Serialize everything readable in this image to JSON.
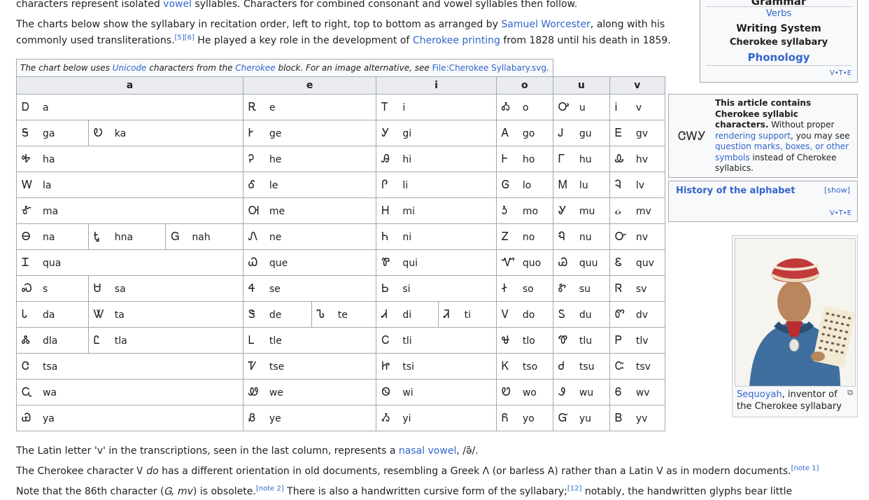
{
  "intro": {
    "line0_a": "characters represent isolated ",
    "line0_link": "vowel",
    "line0_b": " syllables. Characters for combined consonant and vowel syllables then follow.",
    "line1_a": "The charts below show the syllabary in recitation order, left to right, top to bottom as arranged by ",
    "line1_link": "Samuel Worcester",
    "line1_b": ", along with his",
    "line2_a": "commonly used transliterations.",
    "line2_ref": "[5][6]",
    "line2_b": " He played a key role in the development of ",
    "line2_link": "Cherokee printing",
    "line2_c": " from 1828 until his death in 1859."
  },
  "table": {
    "caption_a": "The chart below uses ",
    "caption_link1": "Unicode",
    "caption_b": " characters from the ",
    "caption_link2": "Cherokee",
    "caption_c": " block. For an image alternative, see ",
    "caption_link3": "File:Cherokee Syllabary.svg",
    "caption_d": ".",
    "headers": [
      "a",
      "e",
      "i",
      "o",
      "u",
      "v"
    ],
    "rows": [
      {
        "a": [
          [
            "Ꭰ",
            "a"
          ]
        ],
        "e": [
          [
            "Ꭱ",
            "e"
          ]
        ],
        "i": [
          [
            "Ꭲ",
            "i"
          ]
        ],
        "o": [
          [
            "Ꭳ",
            "o"
          ]
        ],
        "u": [
          [
            "Ꭴ",
            "u"
          ]
        ],
        "v": [
          [
            "Ꭵ",
            "v"
          ]
        ]
      },
      {
        "a": [
          [
            "Ꭶ",
            "ga"
          ],
          [
            "Ꭷ",
            "ka"
          ]
        ],
        "e": [
          [
            "Ꭸ",
            "ge"
          ]
        ],
        "i": [
          [
            "Ꭹ",
            "gi"
          ]
        ],
        "o": [
          [
            "Ꭺ",
            "go"
          ]
        ],
        "u": [
          [
            "Ꭻ",
            "gu"
          ]
        ],
        "v": [
          [
            "Ꭼ",
            "gv"
          ]
        ]
      },
      {
        "a": [
          [
            "Ꭽ",
            "ha"
          ]
        ],
        "e": [
          [
            "Ꭾ",
            "he"
          ]
        ],
        "i": [
          [
            "Ꭿ",
            "hi"
          ]
        ],
        "o": [
          [
            "Ꮀ",
            "ho"
          ]
        ],
        "u": [
          [
            "Ꮁ",
            "hu"
          ]
        ],
        "v": [
          [
            "Ꮂ",
            "hv"
          ]
        ]
      },
      {
        "a": [
          [
            "Ꮃ",
            "la"
          ]
        ],
        "e": [
          [
            "Ꮄ",
            "le"
          ]
        ],
        "i": [
          [
            "Ꮅ",
            "li"
          ]
        ],
        "o": [
          [
            "Ꮆ",
            "lo"
          ]
        ],
        "u": [
          [
            "Ꮇ",
            "lu"
          ]
        ],
        "v": [
          [
            "Ꮈ",
            "lv"
          ]
        ]
      },
      {
        "a": [
          [
            "Ꮉ",
            "ma"
          ]
        ],
        "e": [
          [
            "Ꮊ",
            "me"
          ]
        ],
        "i": [
          [
            "Ꮋ",
            "mi"
          ]
        ],
        "o": [
          [
            "Ꮌ",
            "mo"
          ]
        ],
        "u": [
          [
            "Ꮍ",
            "mu"
          ]
        ],
        "v": [
          [
            "ᏽ",
            "mv"
          ]
        ]
      },
      {
        "a": [
          [
            "Ꮎ",
            "na"
          ],
          [
            "Ꮏ",
            "hna"
          ],
          [
            "Ꮐ",
            "nah"
          ]
        ],
        "e": [
          [
            "Ꮑ",
            "ne"
          ]
        ],
        "i": [
          [
            "Ꮒ",
            "ni"
          ]
        ],
        "o": [
          [
            "Ꮓ",
            "no"
          ]
        ],
        "u": [
          [
            "Ꮔ",
            "nu"
          ]
        ],
        "v": [
          [
            "Ꮕ",
            "nv"
          ]
        ]
      },
      {
        "a": [
          [
            "Ꮖ",
            "qua"
          ]
        ],
        "e": [
          [
            "Ꮗ",
            "que"
          ]
        ],
        "i": [
          [
            "Ꮘ",
            "qui"
          ]
        ],
        "o": [
          [
            "Ꮙ",
            "quo"
          ]
        ],
        "u": [
          [
            "Ꮚ",
            "quu"
          ]
        ],
        "v": [
          [
            "Ꮛ",
            "quv"
          ]
        ]
      },
      {
        "a": [
          [
            "Ꮝ",
            "s"
          ],
          [
            "Ꮜ",
            "sa"
          ]
        ],
        "e": [
          [
            "Ꮞ",
            "se"
          ]
        ],
        "i": [
          [
            "Ꮟ",
            "si"
          ]
        ],
        "o": [
          [
            "Ꮠ",
            "so"
          ]
        ],
        "u": [
          [
            "Ꮡ",
            "su"
          ]
        ],
        "v": [
          [
            "Ꮢ",
            "sv"
          ]
        ]
      },
      {
        "a": [
          [
            "Ꮣ",
            "da"
          ],
          [
            "Ꮤ",
            "ta"
          ]
        ],
        "e": [
          [
            "Ꮥ",
            "de"
          ],
          [
            "Ꮦ",
            "te"
          ]
        ],
        "i": [
          [
            "Ꮧ",
            "di"
          ],
          [
            "Ꮨ",
            "ti"
          ]
        ],
        "o": [
          [
            "Ꮩ",
            "do"
          ]
        ],
        "u": [
          [
            "Ꮪ",
            "du"
          ]
        ],
        "v": [
          [
            "Ꮫ",
            "dv"
          ]
        ]
      },
      {
        "a": [
          [
            "Ꮬ",
            "dla"
          ],
          [
            "Ꮭ",
            "tla"
          ]
        ],
        "e": [
          [
            "Ꮮ",
            "tle"
          ]
        ],
        "i": [
          [
            "Ꮯ",
            "tli"
          ]
        ],
        "o": [
          [
            "Ꮰ",
            "tlo"
          ]
        ],
        "u": [
          [
            "Ꮱ",
            "tlu"
          ]
        ],
        "v": [
          [
            "Ꮲ",
            "tlv"
          ]
        ]
      },
      {
        "a": [
          [
            "Ꮳ",
            "tsa"
          ]
        ],
        "e": [
          [
            "Ꮴ",
            "tse"
          ]
        ],
        "i": [
          [
            "Ꮵ",
            "tsi"
          ]
        ],
        "o": [
          [
            "Ꮶ",
            "tso"
          ]
        ],
        "u": [
          [
            "Ꮷ",
            "tsu"
          ]
        ],
        "v": [
          [
            "Ꮸ",
            "tsv"
          ]
        ]
      },
      {
        "a": [
          [
            "Ꮹ",
            "wa"
          ]
        ],
        "e": [
          [
            "Ꮺ",
            "we"
          ]
        ],
        "i": [
          [
            "Ꮻ",
            "wi"
          ]
        ],
        "o": [
          [
            "Ꮼ",
            "wo"
          ]
        ],
        "u": [
          [
            "Ꮽ",
            "wu"
          ]
        ],
        "v": [
          [
            "Ꮾ",
            "wv"
          ]
        ]
      },
      {
        "a": [
          [
            "Ꮿ",
            "ya"
          ]
        ],
        "e": [
          [
            "Ᏸ",
            "ye"
          ]
        ],
        "i": [
          [
            "Ᏹ",
            "yi"
          ]
        ],
        "o": [
          [
            "Ᏺ",
            "yo"
          ]
        ],
        "u": [
          [
            "Ᏻ",
            "yu"
          ]
        ],
        "v": [
          [
            "Ᏼ",
            "yv"
          ]
        ]
      }
    ]
  },
  "after": {
    "p1_a": "The Latin letter 'v' in the transcriptions, seen in the last column, represents a ",
    "p1_link": "nasal vowel",
    "p1_b": ", /ə̃/.",
    "p2_a": "The Cherokee character Ꮩ ",
    "p2_i": "do",
    "p2_b": " has a different orientation in old documents, resembling a Greek Λ (or barless A) rather than a Latin V as in modern documents.",
    "p2_ref": "[note 1]",
    "p3_a": "Note that the 86th character (",
    "p3_i": "Ꮐ, mv",
    "p3_b": ") is obsolete.",
    "p3_ref1": "[note 2]",
    "p3_c": " There is also a handwritten cursive form of the syllabary;",
    "p3_ref2": "[12]",
    "p3_d": " notably, the handwritten glyphs bear little"
  },
  "navbox": {
    "grammar": "Grammar",
    "verbs": "Verbs",
    "writing_system": "Writing System",
    "cherokee_syllabary": "Cherokee syllabary",
    "phonology": "Phonology",
    "v": "V",
    "t": "T",
    "e": "E"
  },
  "notice": {
    "glyph": "ᏣᎳᎩ",
    "bold": "This article contains Cherokee syllabic characters.",
    "t1": " Without proper ",
    "link1": "rendering support",
    "t2": ", you may see ",
    "link2": "question marks, boxes, or other symbols",
    "t3": " instead of Cherokee syllabics."
  },
  "history": {
    "title": "History of the alphabet",
    "show": "[show]",
    "v": "V",
    "t": "T",
    "e": "E"
  },
  "thumb": {
    "caption_link": "Sequoyah",
    "caption_rest": ", inventor of the Cherokee syllabary"
  },
  "colors": {
    "link": "#3366cc",
    "border": "#a2a9b1",
    "header_bg": "#eaecf0"
  }
}
